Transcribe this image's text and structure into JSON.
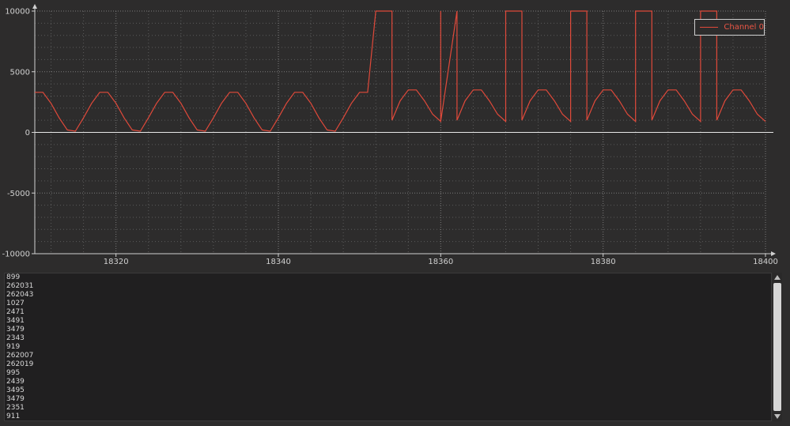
{
  "chart_data": {
    "type": "line",
    "title": "",
    "xlabel": "",
    "ylabel": "",
    "xlim": [
      18310,
      18400
    ],
    "ylim": [
      -10000,
      10000
    ],
    "x_ticks": [
      18320,
      18340,
      18360,
      18380,
      18400
    ],
    "y_ticks": [
      -10000,
      -5000,
      0,
      5000,
      10000
    ],
    "grid": true,
    "legend": "top-right",
    "series": [
      {
        "name": "Channel 0",
        "color": "#e0493a",
        "x": [
          18310,
          18311,
          18312,
          18313,
          18314,
          18315,
          18316,
          18317,
          18318,
          18319,
          18320,
          18321,
          18322,
          18323,
          18324,
          18325,
          18326,
          18327,
          18328,
          18329,
          18330,
          18331,
          18332,
          18333,
          18334,
          18335,
          18336,
          18337,
          18338,
          18339,
          18340,
          18341,
          18342,
          18343,
          18344,
          18345,
          18346,
          18347,
          18348,
          18349,
          18350,
          18351,
          18352,
          18352,
          18354,
          18354,
          18355,
          18356,
          18357,
          18358,
          18359,
          18360,
          18360,
          18360,
          18362,
          18362,
          18363,
          18364,
          18365,
          18366,
          18367,
          18368,
          18368,
          18370,
          18370,
          18371,
          18372,
          18373,
          18374,
          18375,
          18376,
          18376,
          18378,
          18378,
          18379,
          18380,
          18381,
          18382,
          18383,
          18384,
          18384,
          18386,
          18386,
          18387,
          18388,
          18389,
          18390,
          18391,
          18392,
          18392,
          18394,
          18394,
          18395,
          18396,
          18397,
          18398,
          18399,
          18400
        ],
        "y": [
          3300,
          3300,
          2400,
          1200,
          200,
          100,
          1200,
          2400,
          3300,
          3300,
          2400,
          1200,
          200,
          100,
          1200,
          2400,
          3300,
          3300,
          2400,
          1200,
          200,
          100,
          1200,
          2400,
          3300,
          3300,
          2400,
          1200,
          200,
          100,
          1200,
          2400,
          3300,
          3300,
          2400,
          1200,
          200,
          100,
          1200,
          2400,
          3300,
          3300,
          10000,
          10000,
          10000,
          1000,
          2600,
          3500,
          3500,
          2600,
          1500,
          900,
          10000,
          900,
          10000,
          1000,
          2600,
          3500,
          3500,
          2600,
          1500,
          900,
          10000,
          10000,
          1000,
          2600,
          3500,
          3500,
          2600,
          1500,
          900,
          10000,
          10000,
          1000,
          2600,
          3500,
          3500,
          2600,
          1500,
          900,
          10000,
          10000,
          1000,
          2600,
          3500,
          3500,
          2600,
          1500,
          900,
          10000,
          10000,
          1000,
          2600,
          3500,
          3500,
          2600,
          1500,
          900
        ]
      }
    ]
  },
  "legend": {
    "label": "Channel 0"
  },
  "log": {
    "lines": [
      "899",
      "262031",
      "262043",
      "1027",
      "2471",
      "3491",
      "3479",
      "2343",
      "919",
      "262007",
      "262019",
      "995",
      "2439",
      "3495",
      "3479",
      "2351",
      "911"
    ]
  },
  "colors": {
    "background": "#2d2c2c",
    "plot_line": "#e0493a",
    "legend_text": "#ea5545",
    "axis": "#d0d0d0",
    "grid": "#7a7a7a"
  }
}
